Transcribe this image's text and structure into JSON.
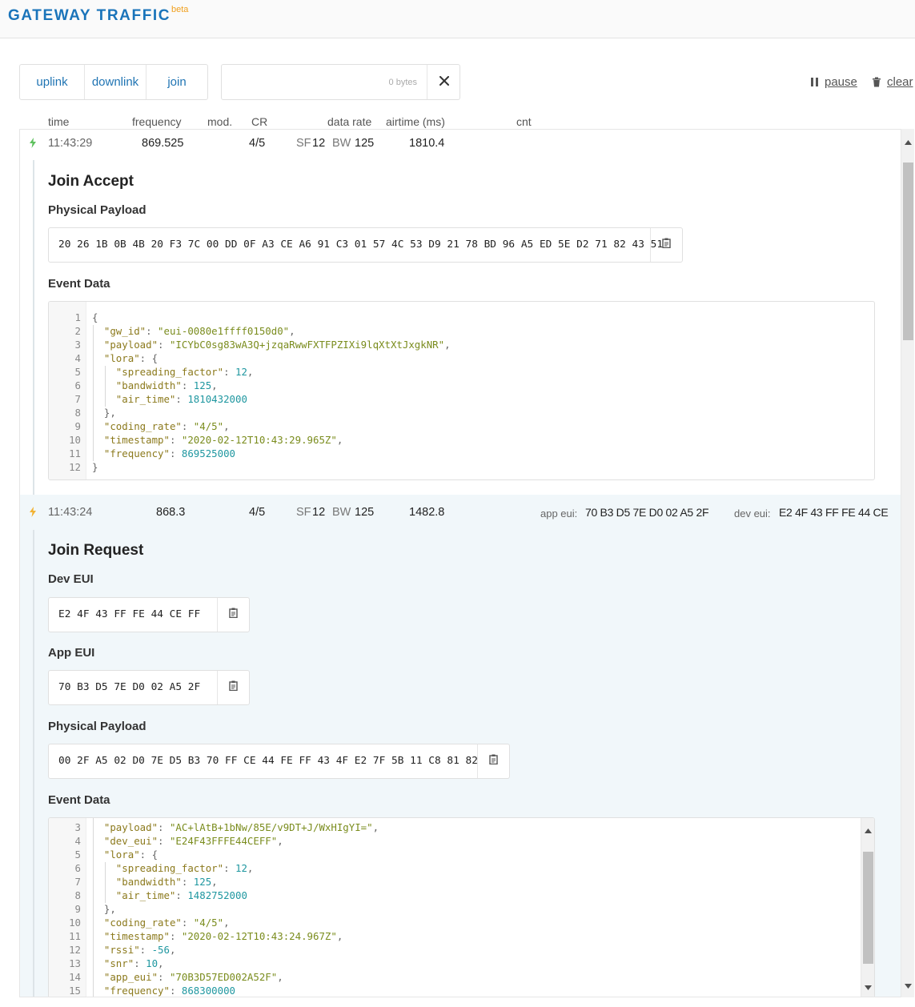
{
  "app": {
    "title": "GATEWAY TRAFFIC",
    "badge": "beta"
  },
  "filters": [
    "uplink",
    "downlink",
    "join"
  ],
  "search": {
    "value": "",
    "placeholder": "0 bytes"
  },
  "controls": {
    "pause": "pause",
    "clear": "clear"
  },
  "columns": {
    "time": "time",
    "frequency": "frequency",
    "mod": "mod.",
    "cr": "CR",
    "data_rate": "data rate",
    "airtime": "airtime (ms)",
    "cnt": "cnt"
  },
  "packets": [
    {
      "time": "11:43:29",
      "frequency": "869.525",
      "cr": "4/5",
      "sf_label": "SF",
      "sf": "12",
      "bw_label": "BW",
      "bw": "125",
      "airtime": "1810.4",
      "direction_icon": "downlink-arrow-icon",
      "title": "Join Accept",
      "physical_label": "Physical Payload",
      "physical_payload": "20 26 1B 0B 4B 20 F3 7C 00 DD 0F A3 CE A6 91 C3 01 57 4C 53 D9 21 78 BD 96 A5 ED 5E D2 71 82 43 51",
      "event_label": "Event Data",
      "event_lines": [
        {
          "n": "1",
          "t": [
            {
              "c": "p",
              "v": "{"
            }
          ]
        },
        {
          "n": "2",
          "t": [
            {
              "c": "k",
              "v": "\"gw_id\""
            },
            {
              "c": "p",
              "v": ": "
            },
            {
              "c": "s",
              "v": "\"eui-0080e1ffff0150d0\""
            },
            {
              "c": "p",
              "v": ","
            }
          ]
        },
        {
          "n": "3",
          "t": [
            {
              "c": "k",
              "v": "\"payload\""
            },
            {
              "c": "p",
              "v": ": "
            },
            {
              "c": "s",
              "v": "\"ICYbC0sg83wA3Q+jzqaRwwFXTFPZIXi9lqXtXtJxgkNR\""
            },
            {
              "c": "p",
              "v": ","
            }
          ]
        },
        {
          "n": "4",
          "t": [
            {
              "c": "k",
              "v": "\"lora\""
            },
            {
              "c": "p",
              "v": ": {"
            }
          ]
        },
        {
          "n": "5",
          "t": [
            {
              "c": "k",
              "v": "\"spreading_factor\""
            },
            {
              "c": "p",
              "v": ": "
            },
            {
              "c": "n",
              "v": "12"
            },
            {
              "c": "p",
              "v": ","
            }
          ]
        },
        {
          "n": "6",
          "t": [
            {
              "c": "k",
              "v": "\"bandwidth\""
            },
            {
              "c": "p",
              "v": ": "
            },
            {
              "c": "n",
              "v": "125"
            },
            {
              "c": "p",
              "v": ","
            }
          ]
        },
        {
          "n": "7",
          "t": [
            {
              "c": "k",
              "v": "\"air_time\""
            },
            {
              "c": "p",
              "v": ": "
            },
            {
              "c": "n",
              "v": "1810432000"
            }
          ]
        },
        {
          "n": "8",
          "t": [
            {
              "c": "p",
              "v": "},"
            }
          ]
        },
        {
          "n": "9",
          "t": [
            {
              "c": "k",
              "v": "\"coding_rate\""
            },
            {
              "c": "p",
              "v": ": "
            },
            {
              "c": "s",
              "v": "\"4/5\""
            },
            {
              "c": "p",
              "v": ","
            }
          ]
        },
        {
          "n": "10",
          "t": [
            {
              "c": "k",
              "v": "\"timestamp\""
            },
            {
              "c": "p",
              "v": ": "
            },
            {
              "c": "s",
              "v": "\"2020-02-12T10:43:29.965Z\""
            },
            {
              "c": "p",
              "v": ","
            }
          ]
        },
        {
          "n": "11",
          "t": [
            {
              "c": "k",
              "v": "\"frequency\""
            },
            {
              "c": "p",
              "v": ": "
            },
            {
              "c": "n",
              "v": "869525000"
            }
          ]
        },
        {
          "n": "12",
          "t": [
            {
              "c": "p",
              "v": "}"
            }
          ]
        }
      ]
    },
    {
      "time": "11:43:24",
      "frequency": "868.3",
      "cr": "4/5",
      "sf_label": "SF",
      "sf": "12",
      "bw_label": "BW",
      "bw": "125",
      "airtime": "1482.8",
      "direction_icon": "uplink-arrow-icon",
      "app_eui_label": "app eui:",
      "app_eui": "70 B3 D5 7E D0 02 A5 2F",
      "dev_eui_label": "dev eui:",
      "dev_eui": "E2 4F 43 FF FE 44 CE",
      "title": "Join Request",
      "dev_eui_heading": "Dev EUI",
      "dev_eui_value": "E2 4F 43 FF FE 44 CE FF",
      "app_eui_heading": "App EUI",
      "app_eui_value": "70 B3 D5 7E D0 02 A5 2F",
      "physical_label": "Physical Payload",
      "physical_payload": "00 2F A5 02 D0 7E D5 B3 70 FF CE 44 FE FF 43 4F E2 7F 5B 11 C8 81 82",
      "event_label": "Event Data",
      "event_lines": [
        {
          "n": "3",
          "t": [
            {
              "c": "k",
              "v": "\"payload\""
            },
            {
              "c": "p",
              "v": ": "
            },
            {
              "c": "s",
              "v": "\"AC+lAtB+1bNw/85E/v9DT+J/WxHIgYI=\""
            },
            {
              "c": "p",
              "v": ","
            }
          ]
        },
        {
          "n": "4",
          "t": [
            {
              "c": "k",
              "v": "\"dev_eui\""
            },
            {
              "c": "p",
              "v": ": "
            },
            {
              "c": "s",
              "v": "\"E24F43FFFE44CEFF\""
            },
            {
              "c": "p",
              "v": ","
            }
          ]
        },
        {
          "n": "5",
          "t": [
            {
              "c": "k",
              "v": "\"lora\""
            },
            {
              "c": "p",
              "v": ": {"
            }
          ]
        },
        {
          "n": "6",
          "t": [
            {
              "c": "k",
              "v": "\"spreading_factor\""
            },
            {
              "c": "p",
              "v": ": "
            },
            {
              "c": "n",
              "v": "12"
            },
            {
              "c": "p",
              "v": ","
            }
          ]
        },
        {
          "n": "7",
          "t": [
            {
              "c": "k",
              "v": "\"bandwidth\""
            },
            {
              "c": "p",
              "v": ": "
            },
            {
              "c": "n",
              "v": "125"
            },
            {
              "c": "p",
              "v": ","
            }
          ]
        },
        {
          "n": "8",
          "t": [
            {
              "c": "k",
              "v": "\"air_time\""
            },
            {
              "c": "p",
              "v": ": "
            },
            {
              "c": "n",
              "v": "1482752000"
            }
          ]
        },
        {
          "n": "9",
          "t": [
            {
              "c": "p",
              "v": "},"
            }
          ]
        },
        {
          "n": "10",
          "t": [
            {
              "c": "k",
              "v": "\"coding_rate\""
            },
            {
              "c": "p",
              "v": ": "
            },
            {
              "c": "s",
              "v": "\"4/5\""
            },
            {
              "c": "p",
              "v": ","
            }
          ]
        },
        {
          "n": "11",
          "t": [
            {
              "c": "k",
              "v": "\"timestamp\""
            },
            {
              "c": "p",
              "v": ": "
            },
            {
              "c": "s",
              "v": "\"2020-02-12T10:43:24.967Z\""
            },
            {
              "c": "p",
              "v": ","
            }
          ]
        },
        {
          "n": "12",
          "t": [
            {
              "c": "k",
              "v": "\"rssi\""
            },
            {
              "c": "p",
              "v": ": "
            },
            {
              "c": "n",
              "v": "-56"
            },
            {
              "c": "p",
              "v": ","
            }
          ]
        },
        {
          "n": "13",
          "t": [
            {
              "c": "k",
              "v": "\"snr\""
            },
            {
              "c": "p",
              "v": ": "
            },
            {
              "c": "n",
              "v": "10"
            },
            {
              "c": "p",
              "v": ","
            }
          ]
        },
        {
          "n": "14",
          "t": [
            {
              "c": "k",
              "v": "\"app_eui\""
            },
            {
              "c": "p",
              "v": ": "
            },
            {
              "c": "s",
              "v": "\"70B3D57ED002A52F\""
            },
            {
              "c": "p",
              "v": ","
            }
          ]
        },
        {
          "n": "15",
          "t": [
            {
              "c": "k",
              "v": "\"frequency\""
            },
            {
              "c": "p",
              "v": ": "
            },
            {
              "c": "n",
              "v": "868300000"
            }
          ]
        }
      ]
    }
  ],
  "icons": {
    "copy": "clipboard-icon",
    "clear": "close-icon",
    "pause": "pause-icon",
    "trash": "trash-icon"
  },
  "colors": {
    "brand": "#1a74ba",
    "beta": "#f0a01e",
    "downlink": "#5ec15e",
    "uplink": "#f2b233",
    "selected_row": "#f1f7fa"
  }
}
